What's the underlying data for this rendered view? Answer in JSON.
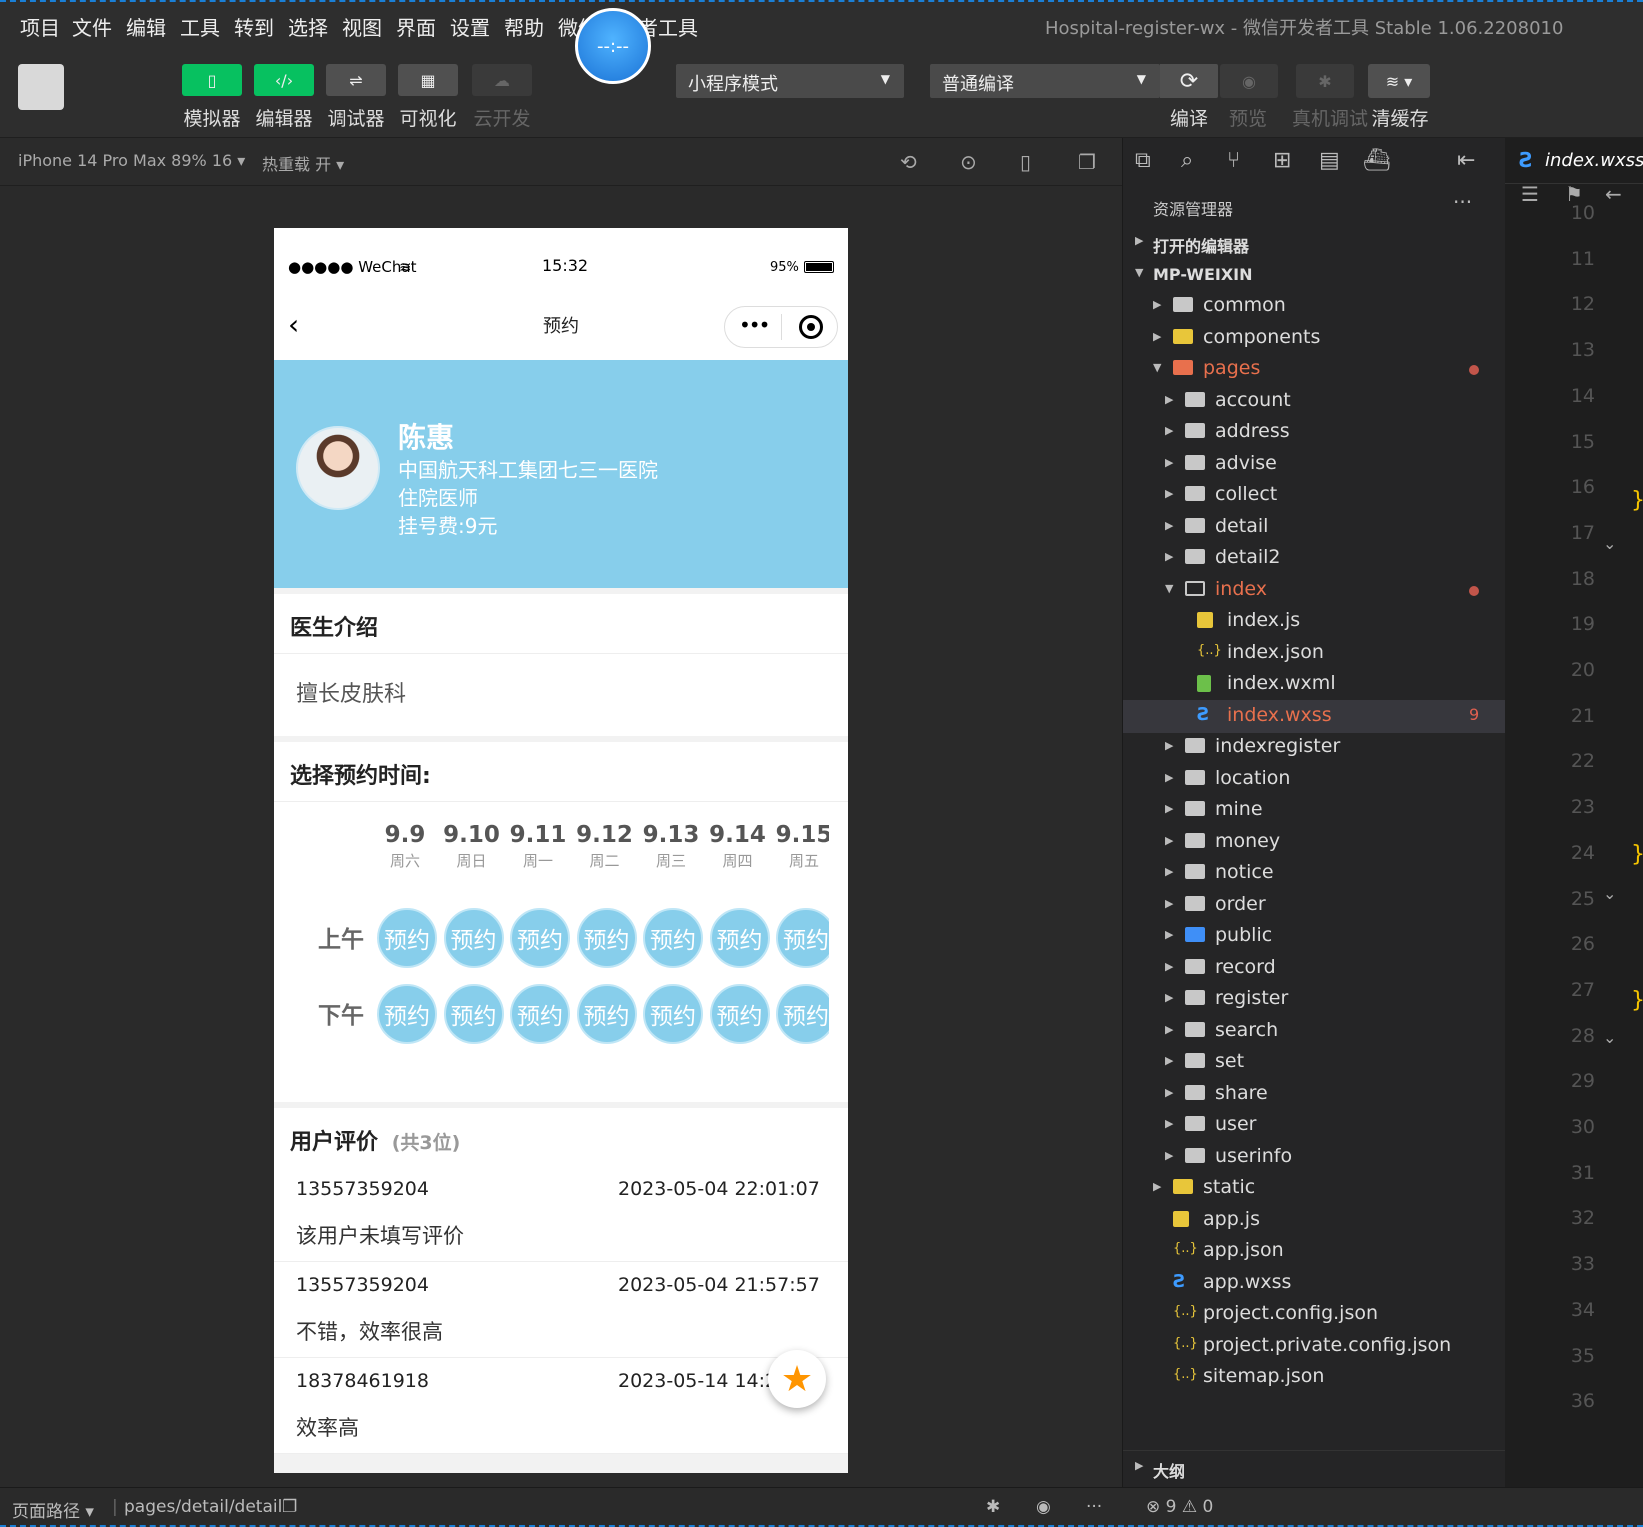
{
  "menu": {
    "items": [
      "项目",
      "文件",
      "编辑",
      "工具",
      "转到",
      "选择",
      "视图",
      "界面",
      "设置",
      "帮助",
      "微信开发者工具"
    ],
    "window_title": "Hospital-register-wx - 微信开发者工具 Stable 1.06.2208010",
    "clock": "--:--"
  },
  "toolbar": {
    "simulator": "模拟器",
    "editor": "编辑器",
    "debugger": "调试器",
    "visualize": "可视化",
    "cloud": "云开发",
    "mode_select": "小程序模式",
    "compile_select": "普通编译",
    "compile": "编译",
    "preview": "预览",
    "real_debug": "真机调试",
    "clear_cache": "清缓存"
  },
  "simulator": {
    "device": "iPhone 14 Pro Max 89% 16",
    "hot_reload": "热重载 开"
  },
  "phone": {
    "status": {
      "carrier": "●●●●● WeChat",
      "time": "15:32",
      "battery": "95%"
    },
    "nav_title": "预约",
    "doctor": {
      "name": "陈惠",
      "hospital": "中国航天科工集团七三一医院",
      "title": "住院医师",
      "fee": "挂号费:9元"
    },
    "intro": {
      "heading": "医生介绍",
      "text": "擅长皮肤科"
    },
    "schedule": {
      "heading": "选择预约时间:",
      "dates": [
        {
          "d": "9.9",
          "w": "周六"
        },
        {
          "d": "9.10",
          "w": "周日"
        },
        {
          "d": "9.11",
          "w": "周一"
        },
        {
          "d": "9.12",
          "w": "周二"
        },
        {
          "d": "9.13",
          "w": "周三"
        },
        {
          "d": "9.14",
          "w": "周四"
        },
        {
          "d": "9.15",
          "w": "周五"
        }
      ],
      "am": "上午",
      "pm": "下午",
      "slot_label": "预约"
    },
    "reviews": {
      "heading": "用户评价",
      "count": "(共3位)",
      "items": [
        {
          "phone": "13557359204",
          "time": "2023-05-04 22:01:07",
          "text": "该用户未填写评价"
        },
        {
          "phone": "13557359204",
          "time": "2023-05-04 21:57:57",
          "text": "不错，效率很高"
        },
        {
          "phone": "18378461918",
          "time": "2023-05-14 14:2",
          "text": "效率高"
        }
      ]
    },
    "fab_icon": "star-icon"
  },
  "explorer": {
    "title": "资源管理器",
    "open_editors": "打开的编辑器",
    "project": "MP-WEIXIN",
    "outline": "大纲",
    "tree": [
      {
        "label": "common",
        "depth": 1,
        "arrow": "▶",
        "type": "folder"
      },
      {
        "label": "components",
        "depth": 1,
        "arrow": "▶",
        "type": "folder-comp"
      },
      {
        "label": "pages",
        "depth": 1,
        "arrow": "▼",
        "type": "folder-pages",
        "dot": true
      },
      {
        "label": "account",
        "depth": 2,
        "arrow": "▶",
        "type": "folder"
      },
      {
        "label": "address",
        "depth": 2,
        "arrow": "▶",
        "type": "folder"
      },
      {
        "label": "advise",
        "depth": 2,
        "arrow": "▶",
        "type": "folder"
      },
      {
        "label": "collect",
        "depth": 2,
        "arrow": "▶",
        "type": "folder"
      },
      {
        "label": "detail",
        "depth": 2,
        "arrow": "▶",
        "type": "folder"
      },
      {
        "label": "detail2",
        "depth": 2,
        "arrow": "▶",
        "type": "folder"
      },
      {
        "label": "index",
        "depth": 2,
        "arrow": "▼",
        "type": "folder-open",
        "dot": true
      },
      {
        "label": "index.js",
        "depth": 3,
        "arrow": "",
        "type": "js"
      },
      {
        "label": "index.json",
        "depth": 3,
        "arrow": "",
        "type": "json"
      },
      {
        "label": "index.wxml",
        "depth": 3,
        "arrow": "",
        "type": "wxml"
      },
      {
        "label": "index.wxss",
        "depth": 3,
        "arrow": "",
        "type": "wxss",
        "count": "9",
        "selected": true
      },
      {
        "label": "indexregister",
        "depth": 2,
        "arrow": "▶",
        "type": "folder"
      },
      {
        "label": "location",
        "depth": 2,
        "arrow": "▶",
        "type": "folder"
      },
      {
        "label": "mine",
        "depth": 2,
        "arrow": "▶",
        "type": "folder"
      },
      {
        "label": "money",
        "depth": 2,
        "arrow": "▶",
        "type": "folder"
      },
      {
        "label": "notice",
        "depth": 2,
        "arrow": "▶",
        "type": "folder"
      },
      {
        "label": "order",
        "depth": 2,
        "arrow": "▶",
        "type": "folder"
      },
      {
        "label": "public",
        "depth": 2,
        "arrow": "▶",
        "type": "folder-public"
      },
      {
        "label": "record",
        "depth": 2,
        "arrow": "▶",
        "type": "folder"
      },
      {
        "label": "register",
        "depth": 2,
        "arrow": "▶",
        "type": "folder"
      },
      {
        "label": "search",
        "depth": 2,
        "arrow": "▶",
        "type": "folder"
      },
      {
        "label": "set",
        "depth": 2,
        "arrow": "▶",
        "type": "folder"
      },
      {
        "label": "share",
        "depth": 2,
        "arrow": "▶",
        "type": "folder"
      },
      {
        "label": "user",
        "depth": 2,
        "arrow": "▶",
        "type": "folder"
      },
      {
        "label": "userinfo",
        "depth": 2,
        "arrow": "▶",
        "type": "folder"
      },
      {
        "label": "static",
        "depth": 1,
        "arrow": "▶",
        "type": "folder-static"
      },
      {
        "label": "app.js",
        "depth": 1,
        "arrow": "",
        "type": "js"
      },
      {
        "label": "app.json",
        "depth": 1,
        "arrow": "",
        "type": "json"
      },
      {
        "label": "app.wxss",
        "depth": 1,
        "arrow": "",
        "type": "wxss"
      },
      {
        "label": "project.config.json",
        "depth": 1,
        "arrow": "",
        "type": "json"
      },
      {
        "label": "project.private.config.json",
        "depth": 1,
        "arrow": "",
        "type": "json"
      },
      {
        "label": "sitemap.json",
        "depth": 1,
        "arrow": "",
        "type": "json"
      }
    ]
  },
  "editor": {
    "tab": "index.wxss",
    "line_numbers": [
      "10",
      "11",
      "12",
      "13",
      "14",
      "15",
      "16",
      "17",
      "18",
      "19",
      "20",
      "21",
      "22",
      "23",
      "24",
      "25",
      "26",
      "27",
      "28",
      "29",
      "30",
      "31",
      "32",
      "33",
      "34",
      "35",
      "36"
    ]
  },
  "footer": {
    "page_path_label": "页面路径",
    "page_path": "pages/detail/detail",
    "errors": "9",
    "warnings": "0"
  },
  "colors": {
    "accent_green": "#07c160",
    "hero_blue": "#87ceeb",
    "star_orange": "#ff9500"
  }
}
